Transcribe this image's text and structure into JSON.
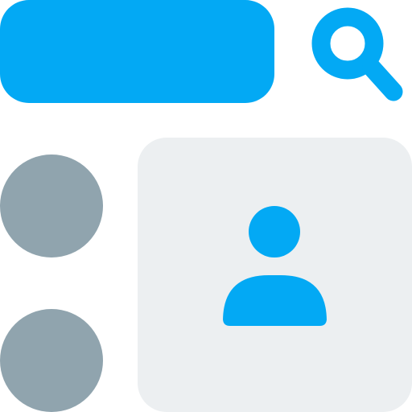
{
  "colors": {
    "accent": "#03A9F4",
    "nav_dot": "#90A4AE",
    "card_background": "#ECEFF1",
    "page_background": "#FFFFFF"
  },
  "icons": {
    "search": "search-icon",
    "user": "user-icon"
  }
}
